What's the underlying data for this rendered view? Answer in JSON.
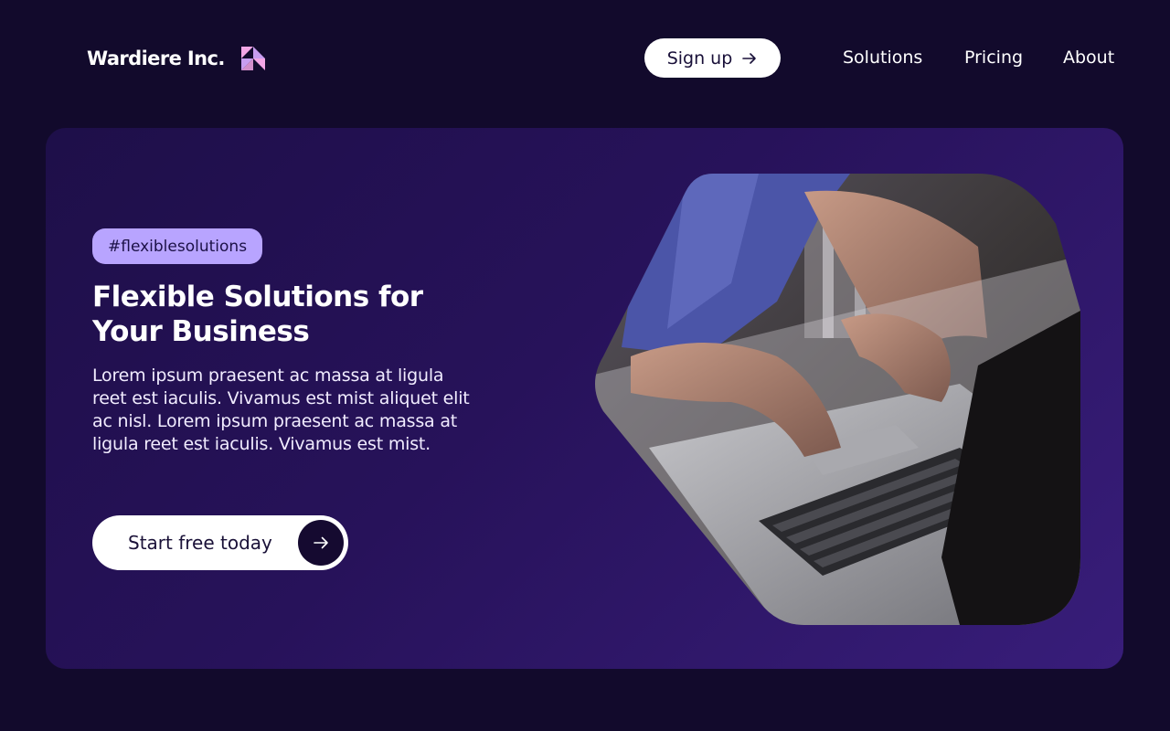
{
  "header": {
    "brand_name": "Wardiere Inc.",
    "signup_label": "Sign up",
    "nav": [
      {
        "label": "Solutions"
      },
      {
        "label": "Pricing"
      },
      {
        "label": "About"
      }
    ]
  },
  "hero": {
    "tag": "#flexiblesolutions",
    "headline": "Flexible Solutions for Your Business",
    "body": "Lorem ipsum praesent ac massa at ligula reet est iaculis. Vivamus est mist aliquet elit ac nisl. Lorem ipsum praesent ac massa at ligula reet est iaculis. Vivamus est mist.",
    "cta_label": "Start free today"
  },
  "icons": {
    "logo": "triangle-logo-icon",
    "signup_arrow": "arrow-right-icon",
    "cta_arrow": "arrow-right-icon"
  },
  "colors": {
    "background": "#120a2c",
    "card_gradient_start": "#1e0f49",
    "card_gradient_end": "#381d7a",
    "tag_background": "#b8a4ff",
    "logo_pink": "#f3a6e6",
    "logo_lilac": "#c79df0"
  }
}
